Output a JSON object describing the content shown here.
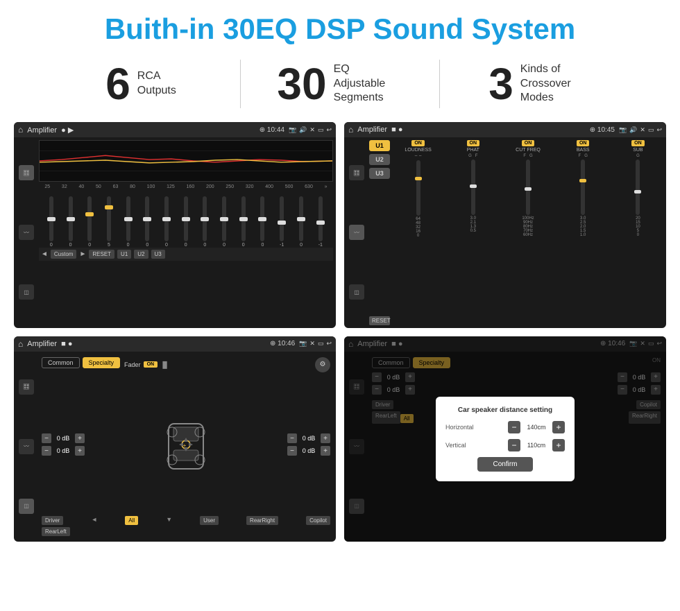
{
  "header": {
    "title": "Buith-in 30EQ DSP Sound System"
  },
  "stats": [
    {
      "number": "6",
      "text": "RCA\nOutputs"
    },
    {
      "number": "30",
      "text": "EQ Adjustable\nSegments"
    },
    {
      "number": "3",
      "text": "Kinds of\nCrossover Modes"
    }
  ],
  "screens": [
    {
      "id": "eq-screen",
      "title": "Amplifier",
      "time": "10:44",
      "type": "eq"
    },
    {
      "id": "amp-u-screen",
      "title": "Amplifier",
      "time": "10:45",
      "type": "amp-u"
    },
    {
      "id": "cs-screen",
      "title": "Amplifier",
      "time": "10:46",
      "type": "cs"
    },
    {
      "id": "dialog-screen",
      "title": "Amplifier",
      "time": "10:46",
      "type": "dialog"
    }
  ],
  "eq": {
    "frequencies": [
      "25",
      "32",
      "40",
      "50",
      "63",
      "80",
      "100",
      "125",
      "160",
      "200",
      "250",
      "320",
      "400",
      "500",
      "630"
    ],
    "values": [
      "0",
      "0",
      "0",
      "5",
      "0",
      "0",
      "0",
      "0",
      "0",
      "0",
      "0",
      "0",
      "-1",
      "0",
      "-1"
    ],
    "presets": [
      "Custom",
      "RESET",
      "U1",
      "U2",
      "U3"
    ]
  },
  "amp_u": {
    "u_buttons": [
      "U1",
      "U2",
      "U3"
    ],
    "sliders": [
      {
        "label": "LOUDNESS",
        "on": true
      },
      {
        "label": "PHAT",
        "on": true
      },
      {
        "label": "CUT FREQ",
        "on": true
      },
      {
        "label": "BASS",
        "on": true
      },
      {
        "label": "SUB",
        "on": true
      }
    ]
  },
  "cs": {
    "tabs": [
      "Common",
      "Specialty"
    ],
    "fader": "Fader",
    "fader_on": "ON",
    "speaker_rows": [
      {
        "value": "0 dB"
      },
      {
        "value": "0 dB"
      },
      {
        "value": "0 dB"
      },
      {
        "value": "0 dB"
      }
    ],
    "bottom_labels": [
      "Driver",
      "All",
      "RearLeft",
      "User",
      "RearRight",
      "Copilot"
    ]
  },
  "dialog": {
    "title": "Car speaker distance setting",
    "rows": [
      {
        "label": "Horizontal",
        "value": "140cm"
      },
      {
        "label": "Vertical",
        "value": "110cm"
      }
    ],
    "confirm_label": "Confirm",
    "speaker_rows": [
      {
        "value": "0 dB"
      },
      {
        "value": "0 dB"
      }
    ]
  }
}
